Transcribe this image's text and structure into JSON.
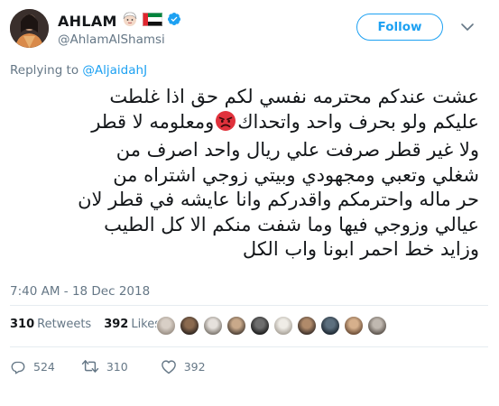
{
  "user": {
    "display_name": "AHLAM",
    "handle": "@AhlamAlShamsi",
    "verified": true,
    "emoji_badges": [
      "woman-emoji",
      "uae-flag"
    ]
  },
  "follow_label": "Follow",
  "replying": {
    "prefix": "Replying to ",
    "target": "@AljaidahJ"
  },
  "tweet": {
    "line1": "عشت عندكم محترمه نفسي لكم حق اذا غلطت",
    "line2a": "عليكم ولو بحرف واحد واتحداك",
    "line2b": "ومعلومه لا قطر",
    "line3": "ولا غير قطر صرفت علي ريال واحد اصرف من",
    "line4": "شغلي وتعبي ومجهودي وبيتي زوجي اشتراه من",
    "line5": "حر ماله واحترمكم واقدركم وانا عايشه في قطر لان",
    "line6": "عيالي وزوجي فيها وما شفت منكم الا كل الطيب",
    "line7": "وزايد خط احمر ابونا واب الكل"
  },
  "timestamp": "7:40 AM - 18 Dec 2018",
  "stats": {
    "retweets_count": "310",
    "retweets_label": "Retweets",
    "likes_count": "392",
    "likes_label": "Likes"
  },
  "likers_count": 10,
  "actions": {
    "replies": "524",
    "retweets": "310",
    "likes": "392"
  },
  "colors": {
    "accent": "#1da1f2",
    "text": "#14171a",
    "secondary": "#657786",
    "divider": "#e6ecf0"
  }
}
